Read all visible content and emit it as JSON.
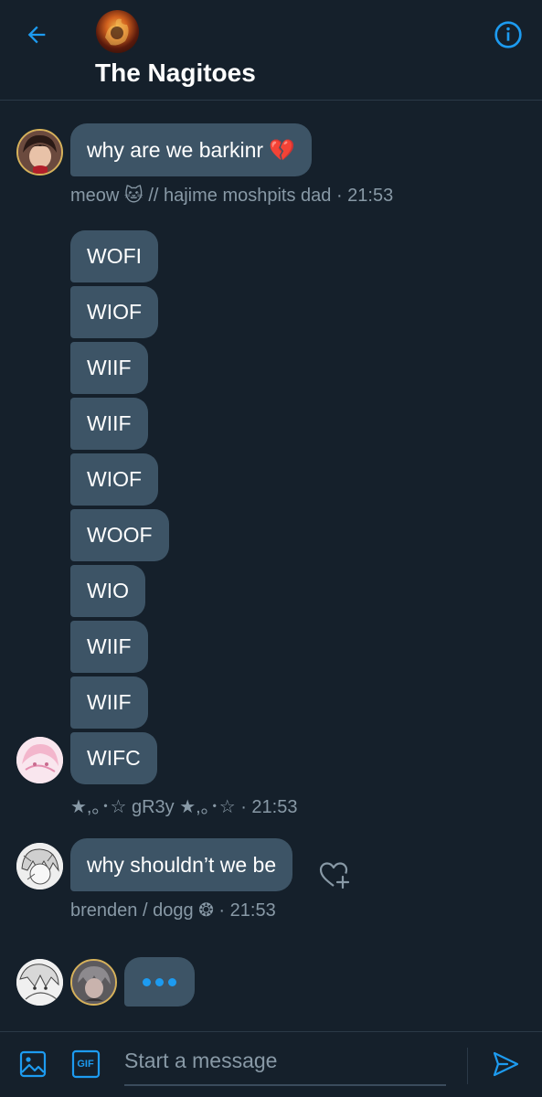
{
  "header": {
    "title": "The Nagitoes",
    "back_icon": "arrow-left-icon",
    "info_icon": "info-icon"
  },
  "messages": [
    {
      "sender": "meow 🐱 // hajime moshpits dad",
      "time": "21:53",
      "bubbles": [
        "why are we barkinr 💔"
      ]
    },
    {
      "sender": "★,｡･☆ gR3y ★,｡･☆",
      "time": "21:53",
      "bubbles": [
        "WOFI",
        "WIOF",
        "WIIF",
        "WIIF",
        "WIOF",
        "WOOF",
        "WIO",
        "WIIF",
        "WIIF",
        "WIFC"
      ]
    },
    {
      "sender": "brenden / dogg ❂",
      "time": "21:53",
      "bubbles": [
        "why shouldn’t we be"
      ]
    }
  ],
  "meta_lines": [
    "meow 🐱 // hajime moshpits dad · 21:53",
    "★,｡･☆ gR3y ★,｡･☆ · 21:53",
    "brenden / dogg ❂ · 21:53"
  ],
  "composer": {
    "placeholder": "Start a message",
    "value": "",
    "gif_label": "GIF"
  },
  "colors": {
    "background": "#15202b",
    "bubble": "#3d5466",
    "accent": "#1d9bf0",
    "meta_text": "#8899a6",
    "like_red": "#e0245e"
  }
}
